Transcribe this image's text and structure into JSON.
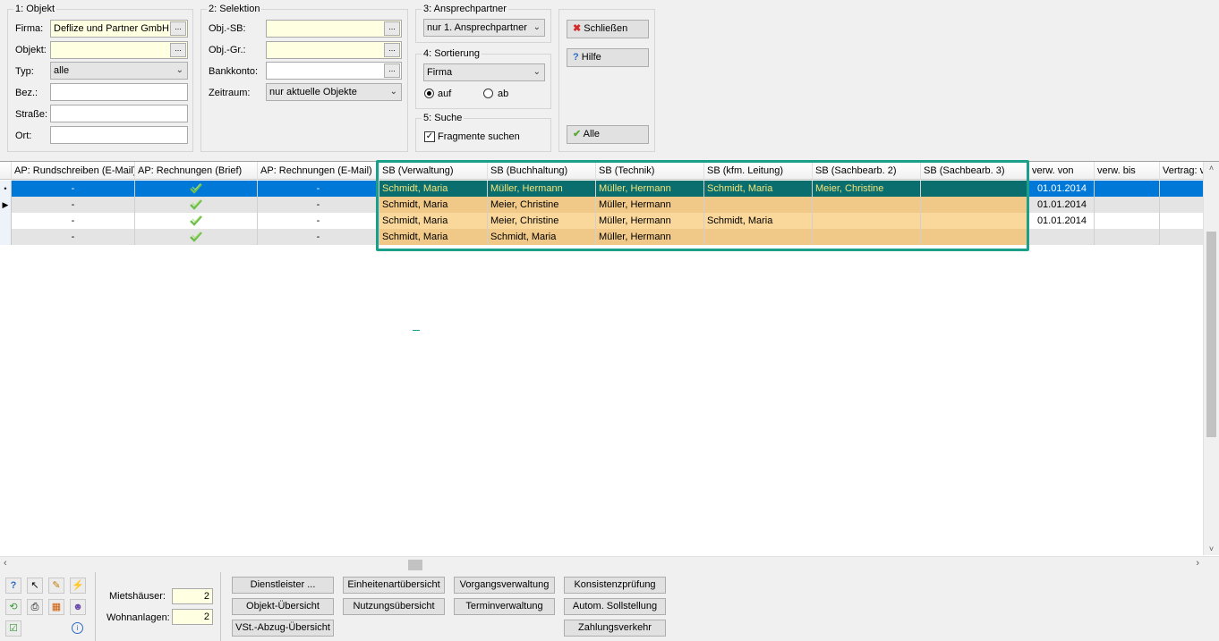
{
  "group1": {
    "label": "1: Objekt",
    "firma_label": "Firma:",
    "firma_value": "Deflize und Partner GmbH",
    "objekt_label": "Objekt:",
    "objekt_value": "",
    "typ_label": "Typ:",
    "typ_value": "alle",
    "bez_label": "Bez.:",
    "strasse_label": "Straße:",
    "ort_label": "Ort:",
    "browse": "..."
  },
  "group2": {
    "label": "2: Selektion",
    "objsb_label": "Obj.-SB:",
    "objgr_label": "Obj.-Gr.:",
    "bankkonto_label": "Bankkonto:",
    "zeitraum_label": "Zeitraum:",
    "zeitraum_value": "nur aktuelle Objekte",
    "browse": "..."
  },
  "group3": {
    "label": "3: Ansprechpartner",
    "value": "nur 1. Ansprechpartner"
  },
  "group4": {
    "label": "4: Sortierung",
    "value": "Firma",
    "auf": "auf",
    "ab": "ab"
  },
  "group5": {
    "label": "5: Suche",
    "fragmente": "Fragmente suchen"
  },
  "actions": {
    "schliessen": "Schließen",
    "hilfe": "Hilfe",
    "alle": "Alle"
  },
  "grid": {
    "columns": [
      "AP: Rundschreiben (E-Mail)",
      "AP: Rechnungen (Brief)",
      "AP: Rechnungen (E-Mail)",
      "SB (Verwaltung)",
      "SB (Buchhaltung)",
      "SB (Technik)",
      "SB (kfm. Leitung)",
      "SB (Sachbearb. 2)",
      "SB (Sachbearb. 3)",
      "verw. von",
      "verw. bis",
      "Vertrag: v"
    ],
    "rows": [
      [
        "-",
        "",
        "-",
        "Schmidt, Maria",
        "Müller, Hermann",
        "Müller, Hermann",
        "Schmidt, Maria",
        "Meier, Christine",
        "",
        "01.01.2014",
        "",
        ""
      ],
      [
        "-",
        "",
        "-",
        "Schmidt, Maria",
        "Meier, Christine",
        "Müller, Hermann",
        "",
        "",
        "",
        "01.01.2014",
        "",
        ""
      ],
      [
        "-",
        "",
        "-",
        "Schmidt, Maria",
        "Meier, Christine",
        "Müller, Hermann",
        "Schmidt, Maria",
        "",
        "",
        "01.01.2014",
        "",
        ""
      ],
      [
        "-",
        "",
        "-",
        "Schmidt, Maria",
        "Schmidt, Maria",
        "Müller, Hermann",
        "",
        "",
        "",
        "",
        "",
        ""
      ]
    ],
    "row_indicators": [
      "•",
      "▶",
      "",
      ""
    ]
  },
  "bottom": {
    "mietshaeuser_label": "Mietshäuser:",
    "mietshaeuser_value": "2",
    "wohnanlagen_label": "Wohnanlagen:",
    "wohnanlagen_value": "2",
    "buttons": [
      "Dienstleister ...",
      "Objekt-Übersicht",
      "VSt.-Abzug-Übersicht",
      "Einheitenartübersicht",
      "Nutzungsübersicht",
      "Vorgangsverwaltung",
      "Terminverwaltung",
      "Konsistenzprüfung",
      "Autom. Sollstellung",
      "Zahlungsverkehr"
    ]
  },
  "colors": {
    "selected_row": "#0a6e6e",
    "highlight_row": "#fad79a",
    "highlight_row_alt": "#f5c98a",
    "frame": "#1aa08a",
    "input_yellow": "#ffffe1"
  }
}
